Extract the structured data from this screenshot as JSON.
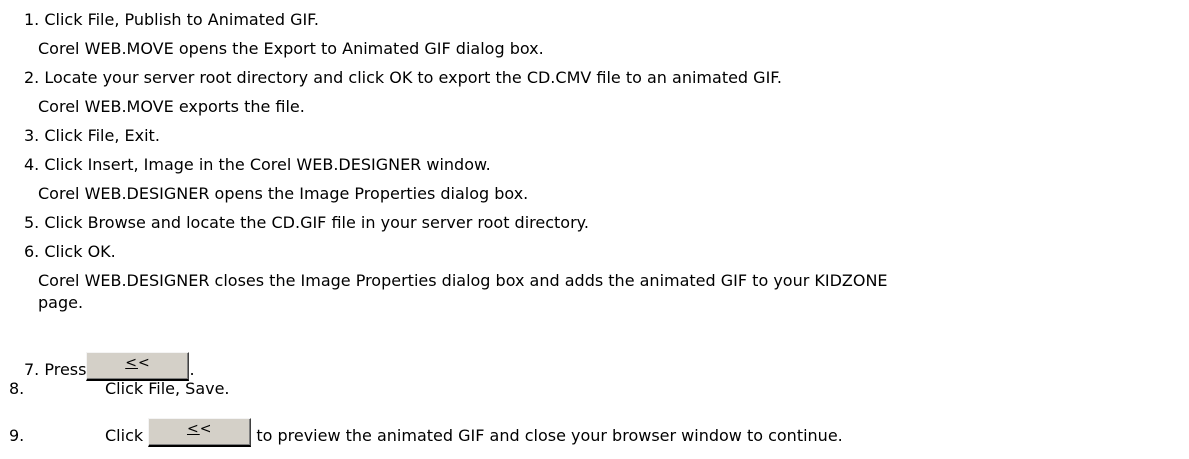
{
  "steps": [
    {
      "number": "1.",
      "text": "Click File, Publish to Animated GIF.",
      "result": "Corel WEB.MOVE opens the Export to Animated GIF dialog box."
    },
    {
      "number": "2.",
      "text": "Locate your server root directory and click OK to export the CD.CMV file to an animated GIF.",
      "result": "Corel WEB.MOVE exports the file."
    },
    {
      "number": "3.",
      "text": "Click File, Exit."
    },
    {
      "number": "4.",
      "text": "Click Insert, Image in the Corel WEB.DESIGNER window.",
      "result": "Corel WEB.DESIGNER opens the Image Properties dialog box."
    },
    {
      "number": "5.",
      "text": "Click Browse and locate the CD.GIF file in your server root directory."
    },
    {
      "number": "6.",
      "text": "Click OK.",
      "result_line1": "Corel WEB.DESIGNER closes the Image Properties dialog box and adds the animated GIF to your KIDZONE",
      "result_line2": "page."
    },
    {
      "number": "7.",
      "text_before": "Press",
      "text_after": "."
    },
    {
      "number": "8.",
      "text": "Click File, Save."
    },
    {
      "number": "9.",
      "text_before": "Click",
      "text_after": "to preview the animated GIF and close your browser window to continue."
    }
  ],
  "back_button": {
    "label": "<<",
    "underlined_char": "<",
    "rest": "<"
  }
}
